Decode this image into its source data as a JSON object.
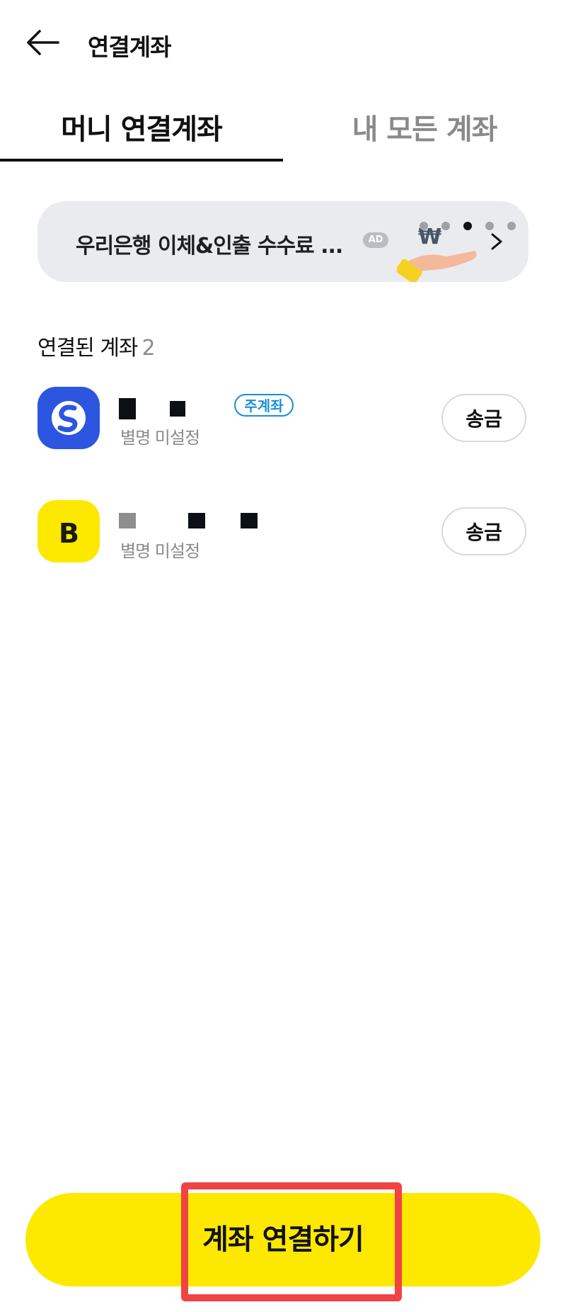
{
  "header": {
    "title": "연결계좌"
  },
  "tabs": [
    {
      "label": "머니 연결계좌",
      "active": true
    },
    {
      "label": "내 모든 계좌",
      "active": false
    }
  ],
  "ad": {
    "text": "우리은행 이체&인출 수수료 ...",
    "badge": "AD",
    "dots_total": 5,
    "dots_active_index": 2
  },
  "accounts_section": {
    "label": "연결된 계좌",
    "count": "2"
  },
  "accounts": [
    {
      "logo": "shinhan-bank-logo",
      "logo_color": "#2c56e0",
      "badge": "주계좌",
      "alias": "별명 미설정",
      "action": "송금"
    },
    {
      "logo": "kakao-bank-logo",
      "logo_color": "#fde800",
      "alias": "별명 미설정",
      "action": "송금"
    }
  ],
  "cta": {
    "label": "계좌 연결하기",
    "color": "#fde800"
  }
}
